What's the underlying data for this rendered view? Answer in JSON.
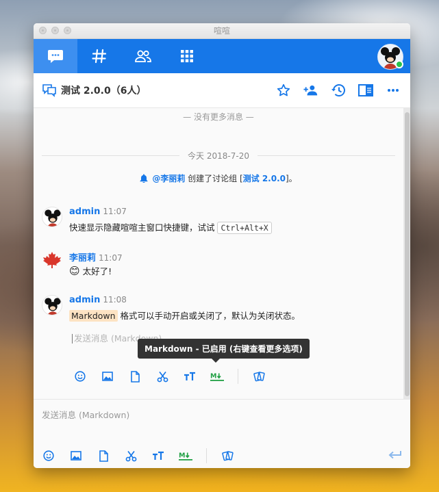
{
  "window": {
    "title": "喧喧"
  },
  "nav": {
    "tabs": [
      "chat",
      "channels",
      "contacts",
      "apps"
    ]
  },
  "chat": {
    "title": "测试 2.0.0（6人）",
    "no_more": "— 没有更多消息 —",
    "date": "今天 2018-7-20",
    "notice": {
      "user": "@李丽莉",
      "text": " 创建了讨论组 [",
      "group": "测试 2.0.0",
      "end": "]。"
    },
    "messages": [
      {
        "name": "admin",
        "time": "11:07",
        "text": "快速显示隐藏喧喧主窗口快捷键，试试 ",
        "kbd": "Ctrl+Alt+X"
      },
      {
        "name": "李丽莉",
        "time": "11:07",
        "emoji": "😊",
        "text": " 太好了!"
      },
      {
        "name": "admin",
        "time": "11:08",
        "highlight": "Markdown",
        "text": " 格式可以手动开启或关闭了，默认为关闭状态。"
      }
    ],
    "edit_placeholder": "发送消息 (Markdown)",
    "tooltip": "Markdown - 已启用 (右键查看更多选项)",
    "input_placeholder": "发送消息 (Markdown)"
  },
  "colors": {
    "primary": "#1677e8",
    "markdown_green": "#22a045",
    "online": "#27c24c"
  }
}
